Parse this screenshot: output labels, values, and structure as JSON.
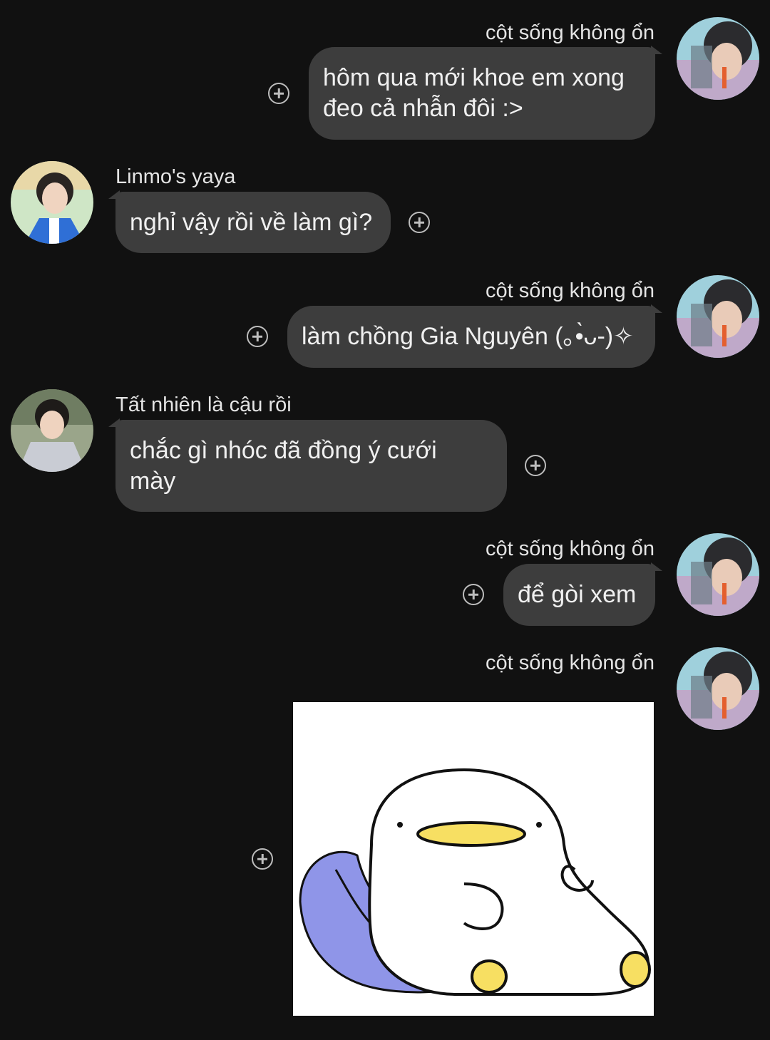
{
  "messages": [
    {
      "sender": "cột sống không ổn",
      "text": "hôm qua mới khoe em xong đeo cả nhẫn đôi :>"
    },
    {
      "sender": "Linmo's yaya",
      "text": "nghỉ vậy rồi về làm gì?"
    },
    {
      "sender": "cột sống không ổn",
      "text": "làm chồng Gia Nguyên (｡•̀ᴗ-)✧"
    },
    {
      "sender": "Tất nhiên là cậu rồi",
      "text": "chắc gì nhóc đã đồng ý cưới mày"
    },
    {
      "sender": "cột sống không ổn",
      "text": "để gòi xem"
    },
    {
      "sender": "cột sống không ổn",
      "sticker": "duck-sticker"
    }
  ],
  "icons": {
    "react": "add-reaction-icon",
    "avatar": "avatar-photo"
  },
  "colors": {
    "background": "#111111",
    "bubble": "#3d3d3d",
    "text": "#f0f0f0"
  }
}
